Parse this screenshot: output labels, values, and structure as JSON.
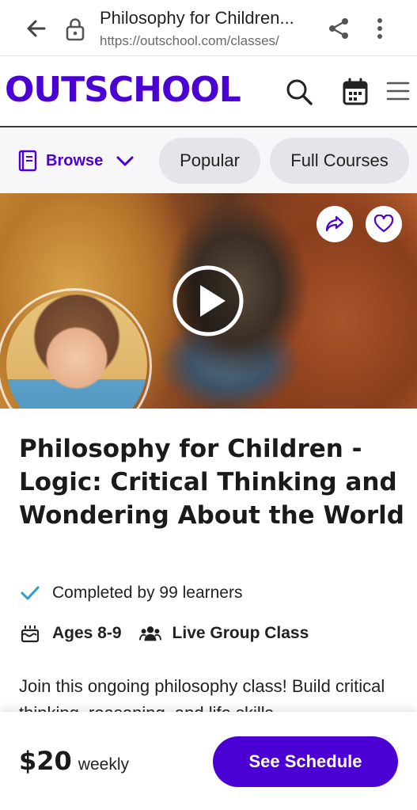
{
  "browser": {
    "tab_title": "Philosophy for Children...",
    "url": "https://outschool.com/classes/",
    "icons": [
      "back-arrow-icon",
      "lock-icon",
      "share-icon",
      "kebab-menu-icon"
    ]
  },
  "header": {
    "logo_text": "OUTSCHOOL",
    "icons": [
      "search-icon",
      "calendar-icon",
      "hamburger-menu-icon"
    ],
    "brand_color": "#4b01d4"
  },
  "nav": {
    "browse_label": "Browse",
    "pills": [
      "Popular",
      "Full Courses"
    ]
  },
  "class": {
    "title": "Philosophy for Children - Logic: Critical Thinking and Wondering About the World",
    "completed_text": "Completed by 99 learners",
    "ages": "Ages 8-9",
    "format": "Live Group Class",
    "description": "Join this ongoing philosophy class! Build critical thinking, reasoning, and life skills"
  },
  "footer": {
    "price": "$20",
    "period": "weekly",
    "cta_label": "See Schedule"
  }
}
